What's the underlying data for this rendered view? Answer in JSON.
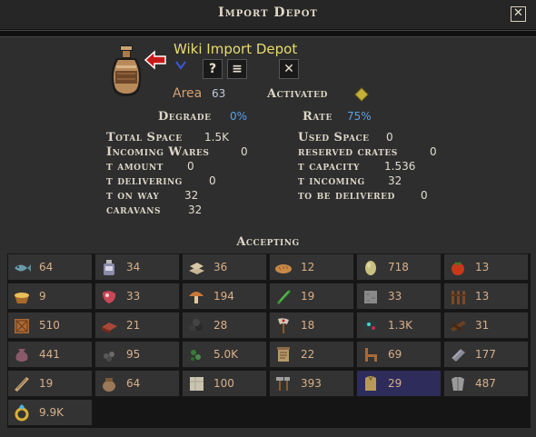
{
  "window": {
    "title": "Import Depot",
    "close_icon": "close-icon"
  },
  "building": {
    "name": "Wiki Import Depot",
    "area_label": "Area",
    "area_value": "63",
    "activated_label": "Activated",
    "degrade_label": "Degrade",
    "degrade_value": "0%",
    "rate_label": "Rate",
    "rate_value": "75%"
  },
  "stats_left": [
    {
      "label": "Total Space",
      "value": "1.5K"
    },
    {
      "label": "Incoming Wares",
      "value": "0"
    },
    {
      "label": "t amount",
      "value": "0"
    },
    {
      "label": "t delivering",
      "value": "0"
    },
    {
      "label": "t on way",
      "value": "32"
    },
    {
      "label": "caravans",
      "value": "32"
    }
  ],
  "stats_right": [
    {
      "label": "Used Space",
      "value": "0"
    },
    {
      "label": "reserved crates",
      "value": "0"
    },
    {
      "label": "t capacity",
      "value": "1.536"
    },
    {
      "label": "t incoming",
      "value": "32"
    },
    {
      "label": "to be delivered",
      "value": "0"
    }
  ],
  "section": {
    "accepting": "Accepting"
  },
  "colors": {
    "bg": "#2e2e2e",
    "yellow": "#e8dc6c",
    "blue": "#5aa0e8",
    "cell_value": "#d8b08a",
    "selected": "#2e2c5a"
  },
  "resources": [
    {
      "icon": "fish-icon",
      "value": "64"
    },
    {
      "icon": "bottle-icon",
      "value": "34"
    },
    {
      "icon": "bricks-icon",
      "value": "36"
    },
    {
      "icon": "bread-icon",
      "value": "12"
    },
    {
      "icon": "egg-icon",
      "value": "718"
    },
    {
      "icon": "tomato-icon",
      "value": "13"
    },
    {
      "icon": "grain-basket-icon",
      "value": "9"
    },
    {
      "icon": "meat-icon",
      "value": "33"
    },
    {
      "icon": "mushroom-icon",
      "value": "194"
    },
    {
      "icon": "cucumber-icon",
      "value": "19"
    },
    {
      "icon": "stone-block-icon",
      "value": "33"
    },
    {
      "icon": "fence-icon",
      "value": "13"
    },
    {
      "icon": "crate-icon",
      "value": "510"
    },
    {
      "icon": "clay-brick-icon",
      "value": "21"
    },
    {
      "icon": "coal-icon",
      "value": "28"
    },
    {
      "icon": "axe-icon",
      "value": "18"
    },
    {
      "icon": "gem-ore-icon",
      "value": "1.3K"
    },
    {
      "icon": "wood-icon",
      "value": "31"
    },
    {
      "icon": "sack-icon",
      "value": "441"
    },
    {
      "icon": "iron-ore-icon",
      "value": "95"
    },
    {
      "icon": "herbs-icon",
      "value": "5.0K"
    },
    {
      "icon": "scroll-icon",
      "value": "22"
    },
    {
      "icon": "chair-icon",
      "value": "69"
    },
    {
      "icon": "ingot-icon",
      "value": "177"
    },
    {
      "icon": "plank-icon",
      "value": "19"
    },
    {
      "icon": "pot-icon",
      "value": "64"
    },
    {
      "icon": "marble-icon",
      "value": "100"
    },
    {
      "icon": "tools-icon",
      "value": "393"
    },
    {
      "icon": "clothes-icon",
      "value": "29",
      "selected": true
    },
    {
      "icon": "armor-icon",
      "value": "487"
    },
    {
      "icon": "ring-icon",
      "value": "9.9K"
    }
  ]
}
